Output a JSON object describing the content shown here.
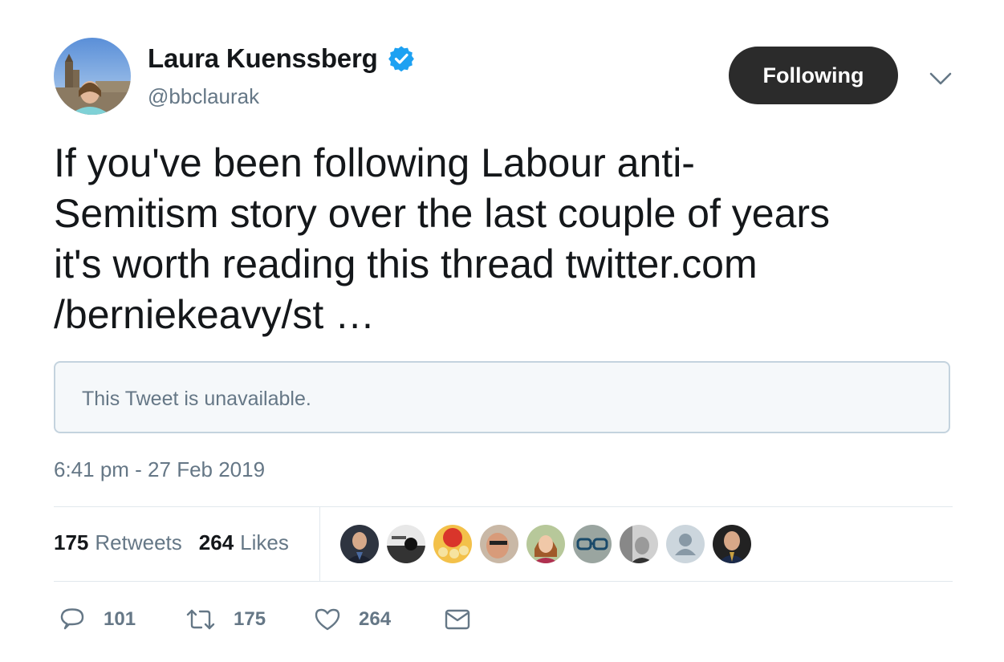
{
  "author": {
    "display_name": "Laura Kuenssberg",
    "handle": "@bbclaurak",
    "verified": true
  },
  "follow_button_label": "Following",
  "tweet": {
    "text_lines": [
      "If you've been following Labour anti-",
      "Semitism story over the last couple of years",
      "it's worth reading this thread ",
      "/berniekeavy/st …"
    ],
    "link_part_1": "twitter.com",
    "quoted_notice": "This Tweet is unavailable.",
    "timestamp": "6:41 pm - 27 Feb 2019"
  },
  "stats": {
    "retweets_count": "175",
    "retweets_label": "Retweets",
    "likes_count": "264",
    "likes_label": "Likes"
  },
  "likers_count": 9,
  "actions": {
    "reply_count": "101",
    "retweet_count": "175",
    "like_count": "264"
  },
  "colors": {
    "text": "#14171a",
    "secondary": "#657786",
    "verified_blue": "#1da1f2",
    "button_bg": "#2b2b2b",
    "border": "#e1e8ed"
  },
  "icons": [
    "verified-badge-icon",
    "chevron-down-icon",
    "reply-icon",
    "retweet-icon",
    "like-heart-icon",
    "direct-message-icon"
  ]
}
